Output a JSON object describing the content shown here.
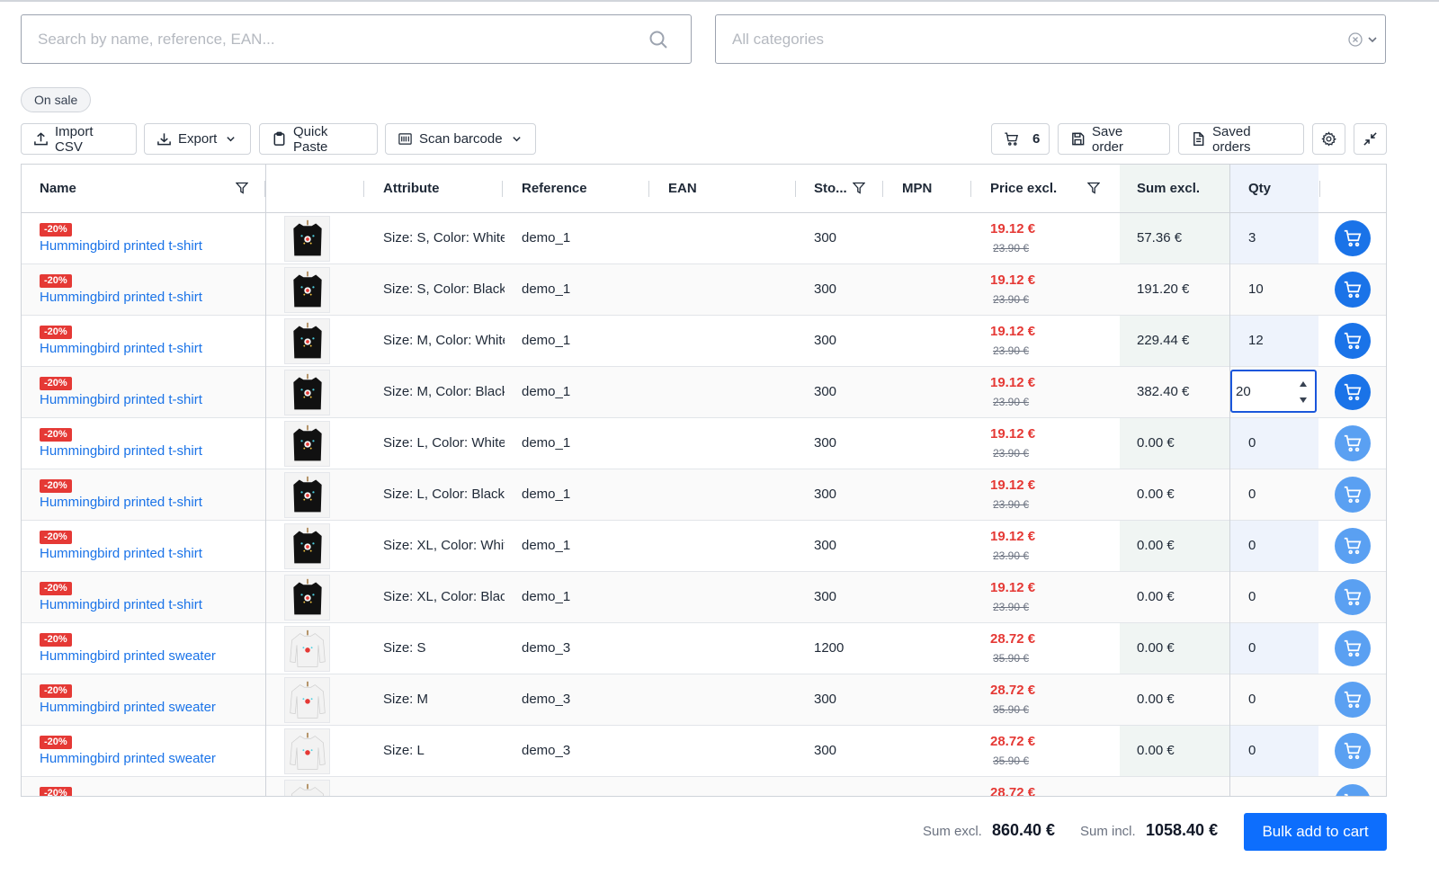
{
  "search": {
    "placeholder": "Search by name, reference, EAN...",
    "value": ""
  },
  "category": {
    "placeholder": "All categories"
  },
  "filter_chip": "On sale",
  "toolbar": {
    "import_csv": "Import CSV",
    "export": "Export",
    "quick_paste": "Quick Paste",
    "scan_barcode": "Scan barcode",
    "cart_count": "6",
    "save_order": "Save order",
    "saved_orders": "Saved orders"
  },
  "columns": {
    "name": "Name",
    "attribute": "Attribute",
    "reference": "Reference",
    "ean": "EAN",
    "stock": "Sto...",
    "mpn": "MPN",
    "price": "Price excl.",
    "sum": "Sum excl.",
    "qty": "Qty"
  },
  "rows": [
    {
      "badge": "-20%",
      "name": "Hummingbird printed t-shirt",
      "thumb": "black-tshirt",
      "attribute": "Size: S, Color: White",
      "reference": "demo_1",
      "ean": "",
      "stock": "300",
      "mpn": "",
      "price_new": "19.12 €",
      "price_old": "23.90 €",
      "sum": "57.36 €",
      "qty": "3"
    },
    {
      "badge": "-20%",
      "name": "Hummingbird printed t-shirt",
      "thumb": "black-tshirt",
      "attribute": "Size: S, Color: Black",
      "reference": "demo_1",
      "ean": "",
      "stock": "300",
      "mpn": "",
      "price_new": "19.12 €",
      "price_old": "23.90 €",
      "sum": "191.20 €",
      "qty": "10"
    },
    {
      "badge": "-20%",
      "name": "Hummingbird printed t-shirt",
      "thumb": "black-tshirt",
      "attribute": "Size: M, Color: White",
      "reference": "demo_1",
      "ean": "",
      "stock": "300",
      "mpn": "",
      "price_new": "19.12 €",
      "price_old": "23.90 €",
      "sum": "229.44 €",
      "qty": "12"
    },
    {
      "badge": "-20%",
      "name": "Hummingbird printed t-shirt",
      "thumb": "black-tshirt",
      "attribute": "Size: M, Color: Black",
      "reference": "demo_1",
      "ean": "",
      "stock": "300",
      "mpn": "",
      "price_new": "19.12 €",
      "price_old": "23.90 €",
      "sum": "382.40 €",
      "qty": "20"
    },
    {
      "badge": "-20%",
      "name": "Hummingbird printed t-shirt",
      "thumb": "black-tshirt",
      "attribute": "Size: L, Color: White",
      "reference": "demo_1",
      "ean": "",
      "stock": "300",
      "mpn": "",
      "price_new": "19.12 €",
      "price_old": "23.90 €",
      "sum": "0.00 €",
      "qty": "0"
    },
    {
      "badge": "-20%",
      "name": "Hummingbird printed t-shirt",
      "thumb": "black-tshirt",
      "attribute": "Size: L, Color: Black",
      "reference": "demo_1",
      "ean": "",
      "stock": "300",
      "mpn": "",
      "price_new": "19.12 €",
      "price_old": "23.90 €",
      "sum": "0.00 €",
      "qty": "0"
    },
    {
      "badge": "-20%",
      "name": "Hummingbird printed t-shirt",
      "thumb": "black-tshirt",
      "attribute": "Size: XL, Color: White",
      "reference": "demo_1",
      "ean": "",
      "stock": "300",
      "mpn": "",
      "price_new": "19.12 €",
      "price_old": "23.90 €",
      "sum": "0.00 €",
      "qty": "0"
    },
    {
      "badge": "-20%",
      "name": "Hummingbird printed t-shirt",
      "thumb": "black-tshirt",
      "attribute": "Size: XL, Color: Black",
      "reference": "demo_1",
      "ean": "",
      "stock": "300",
      "mpn": "",
      "price_new": "19.12 €",
      "price_old": "23.90 €",
      "sum": "0.00 €",
      "qty": "0"
    },
    {
      "badge": "-20%",
      "name": "Hummingbird printed sweater",
      "thumb": "white-sweater",
      "attribute": "Size: S",
      "reference": "demo_3",
      "ean": "",
      "stock": "1200",
      "mpn": "",
      "price_new": "28.72 €",
      "price_old": "35.90 €",
      "sum": "0.00 €",
      "qty": "0"
    },
    {
      "badge": "-20%",
      "name": "Hummingbird printed sweater",
      "thumb": "white-sweater",
      "attribute": "Size: M",
      "reference": "demo_3",
      "ean": "",
      "stock": "300",
      "mpn": "",
      "price_new": "28.72 €",
      "price_old": "35.90 €",
      "sum": "0.00 €",
      "qty": "0"
    },
    {
      "badge": "-20%",
      "name": "Hummingbird printed sweater",
      "thumb": "white-sweater",
      "attribute": "Size: L",
      "reference": "demo_3",
      "ean": "",
      "stock": "300",
      "mpn": "",
      "price_new": "28.72 €",
      "price_old": "35.90 €",
      "sum": "0.00 €",
      "qty": "0"
    },
    {
      "badge": "-20%",
      "name": "",
      "thumb": "white-sweater",
      "attribute": "",
      "reference": "",
      "ean": "",
      "stock": "",
      "mpn": "",
      "price_new": "28.72 €",
      "price_old": "",
      "sum": "",
      "qty": ""
    }
  ],
  "focused_row": 3,
  "footer": {
    "sum_excl_label": "Sum excl.",
    "sum_excl_value": "860.40 €",
    "sum_incl_label": "Sum incl.",
    "sum_incl_value": "1058.40 €",
    "bulk_add": "Bulk add to cart"
  },
  "colors": {
    "accent": "#1a73e8",
    "sale_red": "#e53935",
    "primary_button": "#0d6efd"
  }
}
